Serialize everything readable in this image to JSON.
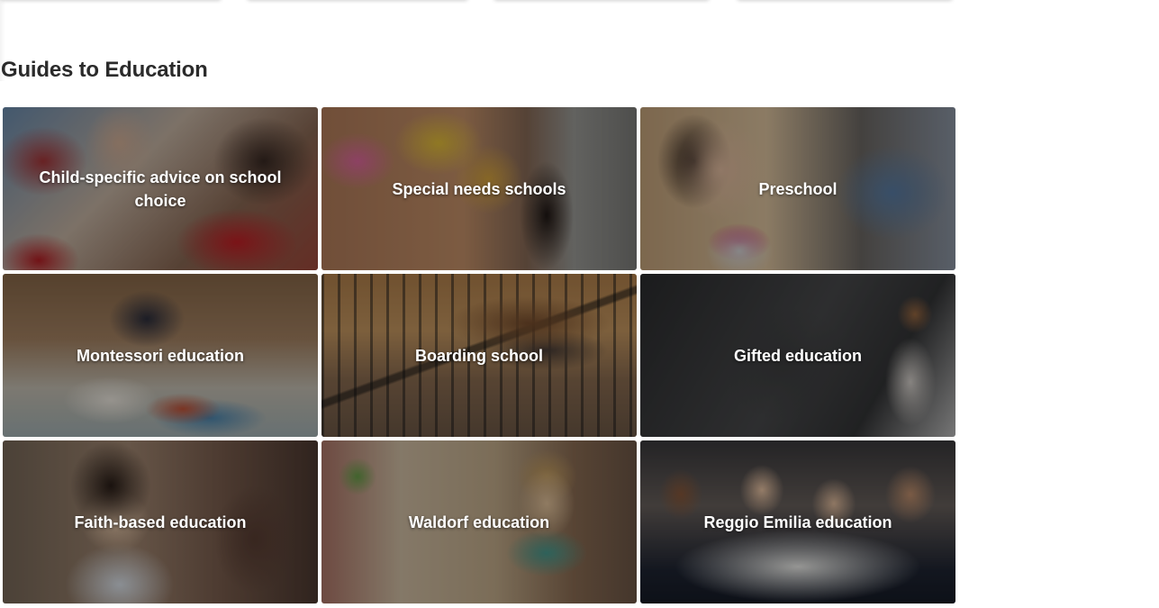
{
  "section": {
    "title": "Guides to Education"
  },
  "guides": [
    {
      "label": "Child-specific advice on school choice"
    },
    {
      "label": "Special needs schools"
    },
    {
      "label": "Preschool"
    },
    {
      "label": "Montessori education"
    },
    {
      "label": "Boarding school"
    },
    {
      "label": "Gifted education"
    },
    {
      "label": "Faith-based education"
    },
    {
      "label": "Waldorf education"
    },
    {
      "label": "Reggio Emilia education"
    }
  ]
}
